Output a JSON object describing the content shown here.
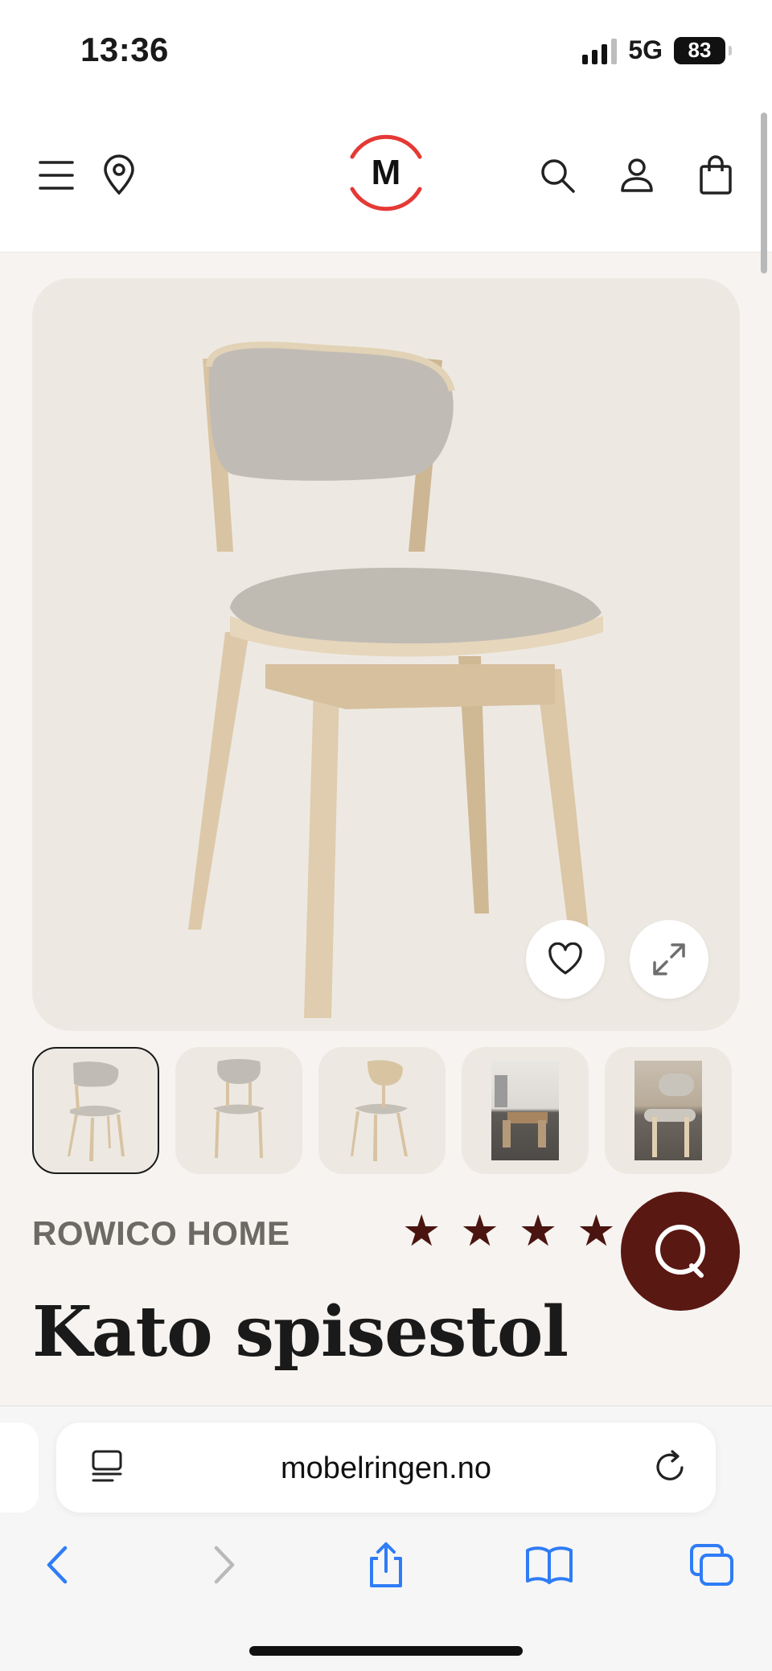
{
  "status_bar": {
    "time": "13:36",
    "network": "5G",
    "battery": "83"
  },
  "header": {
    "logo_letter": "M",
    "icons": [
      "menu-icon",
      "location-pin-icon",
      "search-icon",
      "user-icon",
      "shopping-bag-icon"
    ],
    "logo_color": "#e53935"
  },
  "product": {
    "brand": "ROWICO HOME",
    "title": "Kato spisestol",
    "rating_stars": 5,
    "thumbnail_count": 5,
    "active_thumbnail": 1
  },
  "browser": {
    "url": "mobelringen.no"
  },
  "colors": {
    "accent": "#5a1812",
    "star": "#4a1410",
    "image_bg": "#ede9e2",
    "page_bg": "#f6f3f0",
    "ios_blue": "#2f7cf6"
  }
}
